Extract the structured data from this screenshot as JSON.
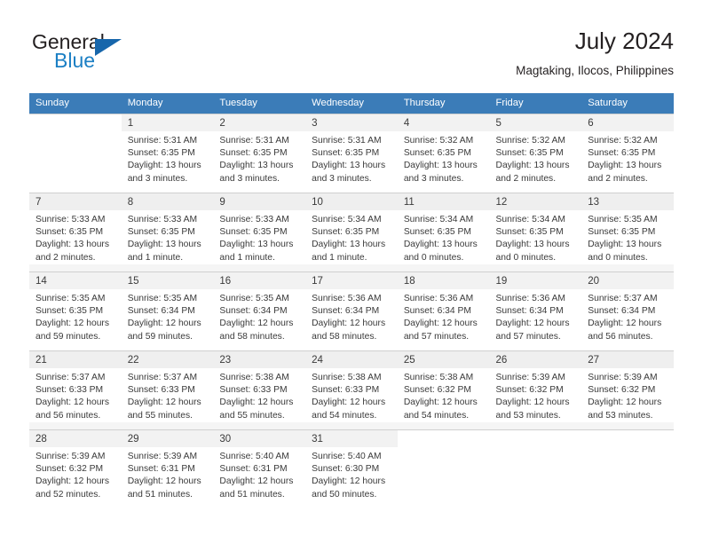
{
  "brand": {
    "line1": "General",
    "line2": "Blue",
    "logo_icon": "triangle-logo-icon",
    "color_text": "#231f20",
    "color_blue": "#1b7fc4",
    "color_triangle": "#1766ab"
  },
  "header": {
    "title": "July 2024",
    "subtitle": "Magtaking, Ilocos, Philippines"
  },
  "theme": {
    "header_bg": "#3b7cb8",
    "header_text": "#ffffff",
    "daynum_bg": "#f2f2f2",
    "row_shaded_bg": "#f5f5f5",
    "grid_line": "#cfcfcf",
    "body_text": "#3a3a3a"
  },
  "calendar": {
    "weekday_headers": [
      "Sunday",
      "Monday",
      "Tuesday",
      "Wednesday",
      "Thursday",
      "Friday",
      "Saturday"
    ],
    "weeks": [
      [
        {
          "day": "",
          "sunrise": "",
          "sunset": "",
          "daylight_line1": "",
          "daylight_line2": ""
        },
        {
          "day": "1",
          "sunrise": "Sunrise: 5:31 AM",
          "sunset": "Sunset: 6:35 PM",
          "daylight_line1": "Daylight: 13 hours",
          "daylight_line2": "and 3 minutes."
        },
        {
          "day": "2",
          "sunrise": "Sunrise: 5:31 AM",
          "sunset": "Sunset: 6:35 PM",
          "daylight_line1": "Daylight: 13 hours",
          "daylight_line2": "and 3 minutes."
        },
        {
          "day": "3",
          "sunrise": "Sunrise: 5:31 AM",
          "sunset": "Sunset: 6:35 PM",
          "daylight_line1": "Daylight: 13 hours",
          "daylight_line2": "and 3 minutes."
        },
        {
          "day": "4",
          "sunrise": "Sunrise: 5:32 AM",
          "sunset": "Sunset: 6:35 PM",
          "daylight_line1": "Daylight: 13 hours",
          "daylight_line2": "and 3 minutes."
        },
        {
          "day": "5",
          "sunrise": "Sunrise: 5:32 AM",
          "sunset": "Sunset: 6:35 PM",
          "daylight_line1": "Daylight: 13 hours",
          "daylight_line2": "and 2 minutes."
        },
        {
          "day": "6",
          "sunrise": "Sunrise: 5:32 AM",
          "sunset": "Sunset: 6:35 PM",
          "daylight_line1": "Daylight: 13 hours",
          "daylight_line2": "and 2 minutes."
        }
      ],
      [
        {
          "day": "7",
          "sunrise": "Sunrise: 5:33 AM",
          "sunset": "Sunset: 6:35 PM",
          "daylight_line1": "Daylight: 13 hours",
          "daylight_line2": "and 2 minutes."
        },
        {
          "day": "8",
          "sunrise": "Sunrise: 5:33 AM",
          "sunset": "Sunset: 6:35 PM",
          "daylight_line1": "Daylight: 13 hours",
          "daylight_line2": "and 1 minute."
        },
        {
          "day": "9",
          "sunrise": "Sunrise: 5:33 AM",
          "sunset": "Sunset: 6:35 PM",
          "daylight_line1": "Daylight: 13 hours",
          "daylight_line2": "and 1 minute."
        },
        {
          "day": "10",
          "sunrise": "Sunrise: 5:34 AM",
          "sunset": "Sunset: 6:35 PM",
          "daylight_line1": "Daylight: 13 hours",
          "daylight_line2": "and 1 minute."
        },
        {
          "day": "11",
          "sunrise": "Sunrise: 5:34 AM",
          "sunset": "Sunset: 6:35 PM",
          "daylight_line1": "Daylight: 13 hours",
          "daylight_line2": "and 0 minutes."
        },
        {
          "day": "12",
          "sunrise": "Sunrise: 5:34 AM",
          "sunset": "Sunset: 6:35 PM",
          "daylight_line1": "Daylight: 13 hours",
          "daylight_line2": "and 0 minutes."
        },
        {
          "day": "13",
          "sunrise": "Sunrise: 5:35 AM",
          "sunset": "Sunset: 6:35 PM",
          "daylight_line1": "Daylight: 13 hours",
          "daylight_line2": "and 0 minutes."
        }
      ],
      [
        {
          "day": "14",
          "sunrise": "Sunrise: 5:35 AM",
          "sunset": "Sunset: 6:35 PM",
          "daylight_line1": "Daylight: 12 hours",
          "daylight_line2": "and 59 minutes."
        },
        {
          "day": "15",
          "sunrise": "Sunrise: 5:35 AM",
          "sunset": "Sunset: 6:34 PM",
          "daylight_line1": "Daylight: 12 hours",
          "daylight_line2": "and 59 minutes."
        },
        {
          "day": "16",
          "sunrise": "Sunrise: 5:35 AM",
          "sunset": "Sunset: 6:34 PM",
          "daylight_line1": "Daylight: 12 hours",
          "daylight_line2": "and 58 minutes."
        },
        {
          "day": "17",
          "sunrise": "Sunrise: 5:36 AM",
          "sunset": "Sunset: 6:34 PM",
          "daylight_line1": "Daylight: 12 hours",
          "daylight_line2": "and 58 minutes."
        },
        {
          "day": "18",
          "sunrise": "Sunrise: 5:36 AM",
          "sunset": "Sunset: 6:34 PM",
          "daylight_line1": "Daylight: 12 hours",
          "daylight_line2": "and 57 minutes."
        },
        {
          "day": "19",
          "sunrise": "Sunrise: 5:36 AM",
          "sunset": "Sunset: 6:34 PM",
          "daylight_line1": "Daylight: 12 hours",
          "daylight_line2": "and 57 minutes."
        },
        {
          "day": "20",
          "sunrise": "Sunrise: 5:37 AM",
          "sunset": "Sunset: 6:34 PM",
          "daylight_line1": "Daylight: 12 hours",
          "daylight_line2": "and 56 minutes."
        }
      ],
      [
        {
          "day": "21",
          "sunrise": "Sunrise: 5:37 AM",
          "sunset": "Sunset: 6:33 PM",
          "daylight_line1": "Daylight: 12 hours",
          "daylight_line2": "and 56 minutes."
        },
        {
          "day": "22",
          "sunrise": "Sunrise: 5:37 AM",
          "sunset": "Sunset: 6:33 PM",
          "daylight_line1": "Daylight: 12 hours",
          "daylight_line2": "and 55 minutes."
        },
        {
          "day": "23",
          "sunrise": "Sunrise: 5:38 AM",
          "sunset": "Sunset: 6:33 PM",
          "daylight_line1": "Daylight: 12 hours",
          "daylight_line2": "and 55 minutes."
        },
        {
          "day": "24",
          "sunrise": "Sunrise: 5:38 AM",
          "sunset": "Sunset: 6:33 PM",
          "daylight_line1": "Daylight: 12 hours",
          "daylight_line2": "and 54 minutes."
        },
        {
          "day": "25",
          "sunrise": "Sunrise: 5:38 AM",
          "sunset": "Sunset: 6:32 PM",
          "daylight_line1": "Daylight: 12 hours",
          "daylight_line2": "and 54 minutes."
        },
        {
          "day": "26",
          "sunrise": "Sunrise: 5:39 AM",
          "sunset": "Sunset: 6:32 PM",
          "daylight_line1": "Daylight: 12 hours",
          "daylight_line2": "and 53 minutes."
        },
        {
          "day": "27",
          "sunrise": "Sunrise: 5:39 AM",
          "sunset": "Sunset: 6:32 PM",
          "daylight_line1": "Daylight: 12 hours",
          "daylight_line2": "and 53 minutes."
        }
      ],
      [
        {
          "day": "28",
          "sunrise": "Sunrise: 5:39 AM",
          "sunset": "Sunset: 6:32 PM",
          "daylight_line1": "Daylight: 12 hours",
          "daylight_line2": "and 52 minutes."
        },
        {
          "day": "29",
          "sunrise": "Sunrise: 5:39 AM",
          "sunset": "Sunset: 6:31 PM",
          "daylight_line1": "Daylight: 12 hours",
          "daylight_line2": "and 51 minutes."
        },
        {
          "day": "30",
          "sunrise": "Sunrise: 5:40 AM",
          "sunset": "Sunset: 6:31 PM",
          "daylight_line1": "Daylight: 12 hours",
          "daylight_line2": "and 51 minutes."
        },
        {
          "day": "31",
          "sunrise": "Sunrise: 5:40 AM",
          "sunset": "Sunset: 6:30 PM",
          "daylight_line1": "Daylight: 12 hours",
          "daylight_line2": "and 50 minutes."
        },
        {
          "day": "",
          "sunrise": "",
          "sunset": "",
          "daylight_line1": "",
          "daylight_line2": ""
        },
        {
          "day": "",
          "sunrise": "",
          "sunset": "",
          "daylight_line1": "",
          "daylight_line2": ""
        },
        {
          "day": "",
          "sunrise": "",
          "sunset": "",
          "daylight_line1": "",
          "daylight_line2": ""
        }
      ]
    ]
  }
}
